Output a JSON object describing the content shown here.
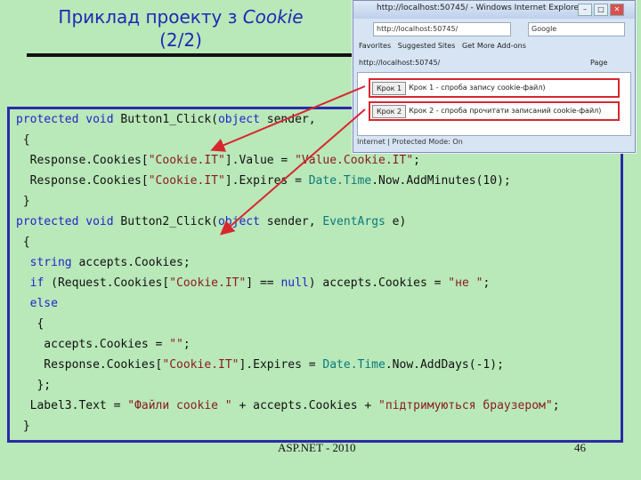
{
  "slide": {
    "title_line1_prefix": "Приклад проекту з ",
    "title_line1_italic": "Cookie",
    "title_line2": "(2/2)",
    "footer_left": "ASP.NET - 2010",
    "footer_right": "46"
  },
  "code_lines": [
    [
      {
        "t": "protected void ",
        "c": "kw"
      },
      {
        "t": "Button1_Click(",
        "c": ""
      },
      {
        "t": "object",
        "c": "kw"
      },
      {
        "t": " sender, ",
        "c": ""
      }
    ],
    [
      {
        "t": " {",
        "c": ""
      }
    ],
    [
      {
        "t": "  Response.Cookies[",
        "c": ""
      },
      {
        "t": "\"Cookie.IT\"",
        "c": "st"
      },
      {
        "t": "].Value = ",
        "c": ""
      },
      {
        "t": "\"Value.Cookie.IT\"",
        "c": "st"
      },
      {
        "t": ";",
        "c": ""
      }
    ],
    [
      {
        "t": "  Response.Cookies[",
        "c": ""
      },
      {
        "t": "\"Cookie.IT\"",
        "c": "st"
      },
      {
        "t": "].Expires = ",
        "c": ""
      },
      {
        "t": "Date.Time",
        "c": "ty"
      },
      {
        "t": ".Now.AddMinutes(10);",
        "c": ""
      }
    ],
    [
      {
        "t": " }",
        "c": ""
      }
    ],
    [
      {
        "t": "protected void ",
        "c": "kw"
      },
      {
        "t": "Button2_Click(",
        "c": ""
      },
      {
        "t": "object",
        "c": "kw"
      },
      {
        "t": " sender, ",
        "c": ""
      },
      {
        "t": "EventArgs",
        "c": "ty"
      },
      {
        "t": " e)",
        "c": ""
      }
    ],
    [
      {
        "t": " {",
        "c": ""
      }
    ],
    [
      {
        "t": "  string",
        "c": "kw"
      },
      {
        "t": " accepts.Cookies;",
        "c": ""
      }
    ],
    [
      {
        "t": "  if",
        "c": "kw"
      },
      {
        "t": " (Request.Cookies[",
        "c": ""
      },
      {
        "t": "\"Cookie.IT\"",
        "c": "st"
      },
      {
        "t": "] == ",
        "c": ""
      },
      {
        "t": "null",
        "c": "kw"
      },
      {
        "t": ") accepts.Cookies = ",
        "c": ""
      },
      {
        "t": "\"не \"",
        "c": "st"
      },
      {
        "t": ";",
        "c": ""
      }
    ],
    [
      {
        "t": "  else",
        "c": "kw"
      }
    ],
    [
      {
        "t": "   {",
        "c": ""
      }
    ],
    [
      {
        "t": "    accepts.Cookies = ",
        "c": ""
      },
      {
        "t": "\"\"",
        "c": "st"
      },
      {
        "t": ";",
        "c": ""
      }
    ],
    [
      {
        "t": "    Response.Cookies[",
        "c": ""
      },
      {
        "t": "\"Cookie.IT\"",
        "c": "st"
      },
      {
        "t": "].Expires = ",
        "c": ""
      },
      {
        "t": "Date.Time",
        "c": "ty"
      },
      {
        "t": ".Now.AddDays(-1);",
        "c": ""
      }
    ],
    [
      {
        "t": "   };",
        "c": ""
      }
    ],
    [
      {
        "t": "  Label3.Text = ",
        "c": ""
      },
      {
        "t": "\"Файли cookie \"",
        "c": "st"
      },
      {
        "t": " + accepts.Cookies + ",
        "c": ""
      },
      {
        "t": "\"підтримуються браузером\"",
        "c": "st"
      },
      {
        "t": ";",
        "c": ""
      }
    ],
    [
      {
        "t": " }",
        "c": ""
      }
    ]
  ],
  "browser": {
    "title": "http://localhost:50745/ - Windows Internet Explorer",
    "address": "http://localhost:50745/",
    "search_placeholder": "Google",
    "favorites": "Favorites",
    "suggested_sites": "Suggested Sites",
    "get_more_addons": "Get More Add-ons",
    "tab_label": "http://localhost:50745/",
    "page_menu": "Page",
    "button1_label": "Крок 1",
    "button1_text": "Крок 1 - спроба запису cookie-файл)",
    "button2_label": "Крок 2",
    "button2_text": "Крок 2 - спроба прочитати записаний cookie-файл)",
    "status": "Internet | Protected Mode: On"
  },
  "colors": {
    "background": "#b9e8b9",
    "title": "#1e2ab3",
    "keyword": "#2424c8",
    "type": "#0b7a7a",
    "string": "#8a1c1c",
    "highlight": "#d8262e"
  }
}
